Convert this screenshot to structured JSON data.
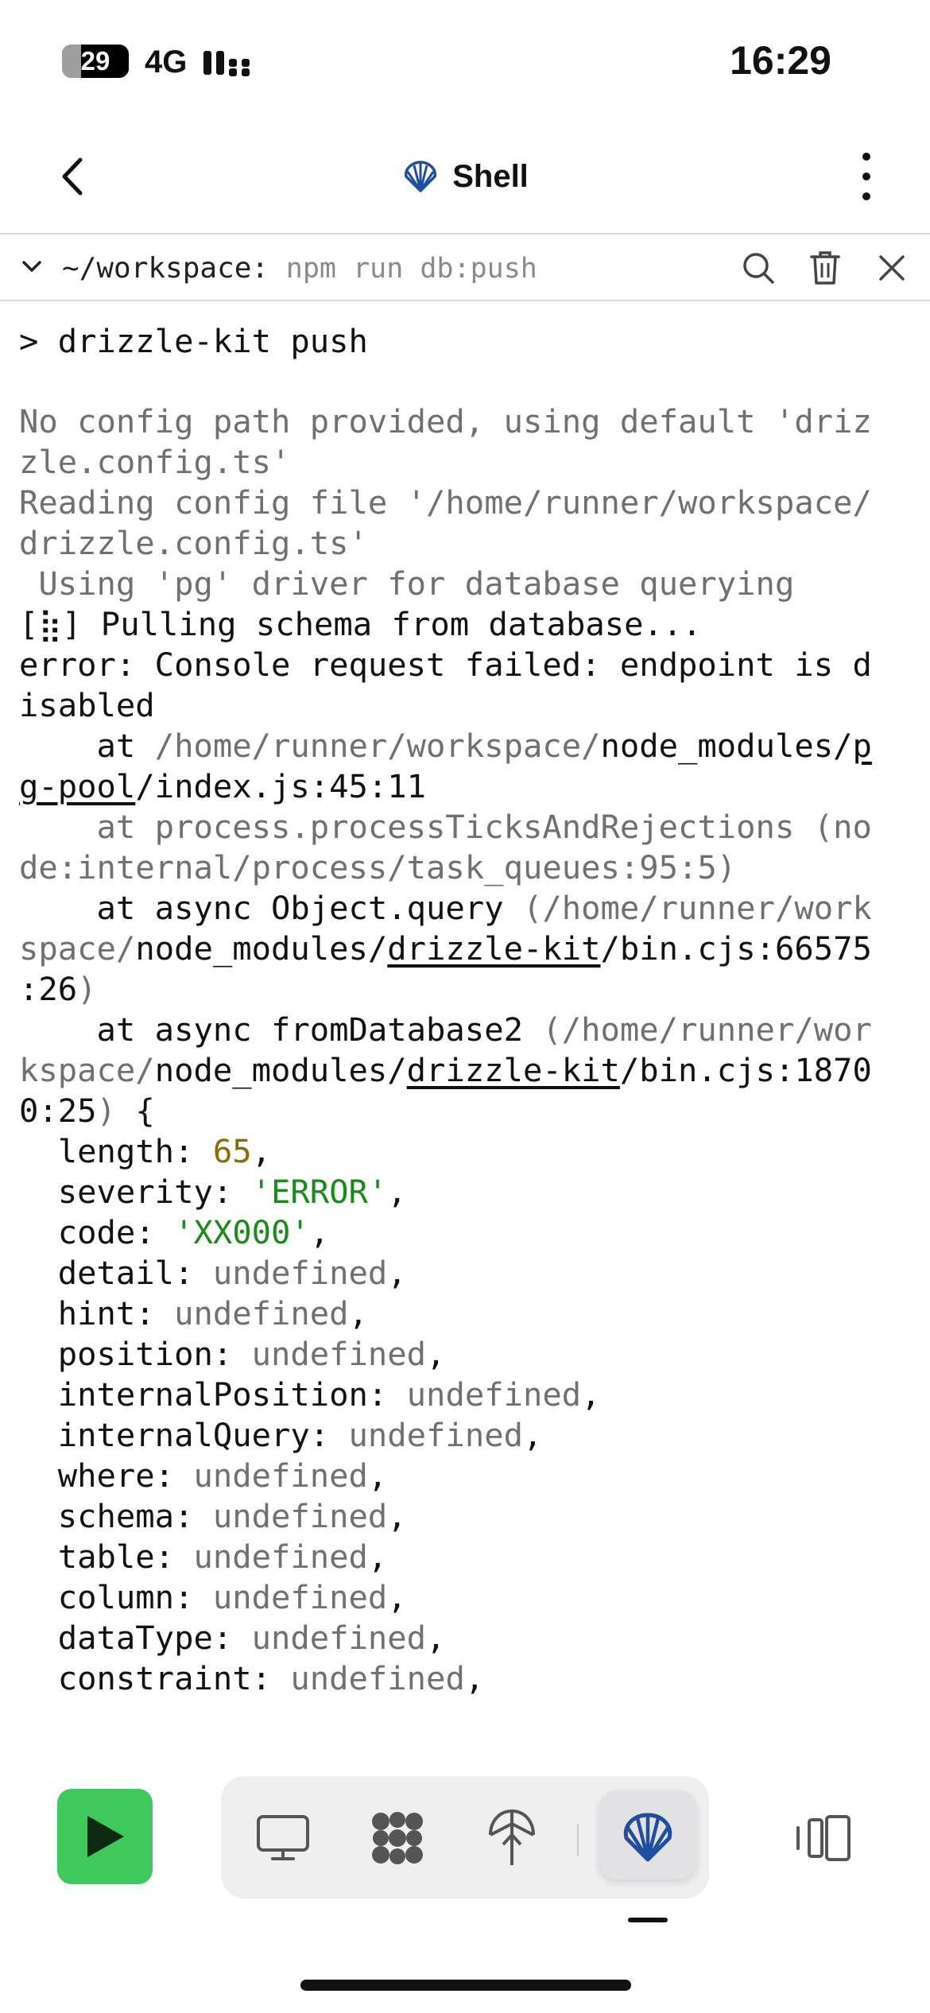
{
  "status_bar": {
    "battery_percent": "29",
    "battery_level": 0.29,
    "network": "4G",
    "time": "16:29"
  },
  "header": {
    "title": "Shell",
    "icon": "shell-icon"
  },
  "shell_tab": {
    "cwd": "~/workspace:",
    "command": "npm run db:push",
    "tools": [
      "search-icon",
      "trash-icon",
      "close-icon"
    ]
  },
  "terminal": {
    "prompt_line": "> drizzle-kit push",
    "lines": {
      "l1": "No config path provided, using default 'driz",
      "l2": "zle.config.ts'",
      "l3": "Reading config file '/home/runner/workspace/",
      "l4": "drizzle.config.ts'",
      "l5": " Using 'pg' driver for database querying",
      "l6": "[⣷] Pulling schema from database...",
      "l7": "error: Console request failed: endpoint is d",
      "l8": "isabled",
      "l9_a": "    at ",
      "l9_b": "/home/runner/workspace/",
      "l9_c": "node_modules/",
      "l9_d": "p",
      "l10_a": "g-pool",
      "l10_b": "/index.js:45:11",
      "l11": "    at process.processTicksAndRejections (no",
      "l12": "de:internal/process/task_queues:95:5)",
      "l13_a": "    at async Object.query ",
      "l13_b": "(/home/runner/work",
      "l14_a": "space/",
      "l14_b": "node_modules/",
      "l14_c": "drizzle-kit",
      "l14_d": "/bin.cjs:66575",
      "l15_a": ":26",
      "l15_b": ")",
      "l16_a": "    at async fromDatabase2 ",
      "l16_b": "(/home/runner/wor",
      "l17_a": "kspace/",
      "l17_b": "node_modules/",
      "l17_c": "drizzle-kit",
      "l17_d": "/bin.cjs:1870",
      "l18_a": "0:25",
      "l18_b": ")",
      "l18_c": " {"
    },
    "props": [
      {
        "key": "  length: ",
        "value": "65",
        "kind": "num"
      },
      {
        "key": "  severity: ",
        "value": "'ERROR'",
        "kind": "str"
      },
      {
        "key": "  code: ",
        "value": "'XX000'",
        "kind": "str"
      },
      {
        "key": "  detail: ",
        "value": "undefined",
        "kind": "gray"
      },
      {
        "key": "  hint: ",
        "value": "undefined",
        "kind": "gray"
      },
      {
        "key": "  position: ",
        "value": "undefined",
        "kind": "gray"
      },
      {
        "key": "  internalPosition: ",
        "value": "undefined",
        "kind": "gray"
      },
      {
        "key": "  internalQuery: ",
        "value": "undefined",
        "kind": "gray"
      },
      {
        "key": "  where: ",
        "value": "undefined",
        "kind": "gray"
      },
      {
        "key": "  schema: ",
        "value": "undefined",
        "kind": "gray"
      },
      {
        "key": "  table: ",
        "value": "undefined",
        "kind": "gray"
      },
      {
        "key": "  column: ",
        "value": "undefined",
        "kind": "gray"
      },
      {
        "key": "  dataType: ",
        "value": "undefined",
        "kind": "gray"
      },
      {
        "key": "  constraint: ",
        "value": "undefined",
        "kind": "gray"
      }
    ],
    "comma": ","
  },
  "dock": {
    "run": "play-icon",
    "items": [
      "monitor-icon",
      "replit-icon",
      "deploy-icon",
      "shell-icon"
    ],
    "side": "panels-icon",
    "accent": "#3ec95a"
  }
}
